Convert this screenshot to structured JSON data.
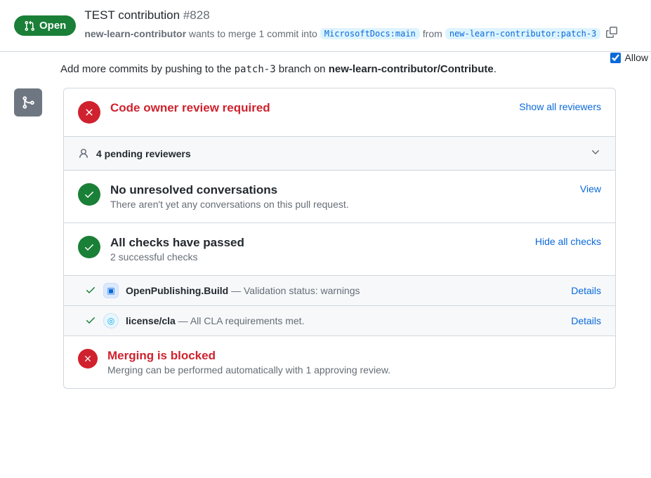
{
  "header": {
    "status_label": "Open",
    "title": "TEST contribution",
    "issue_number": "#828",
    "author": "new-learn-contributor",
    "wants": " wants to merge 1 commit into ",
    "base_branch": "MicrosoftDocs:main",
    "from_word": " from ",
    "head_branch": "new-learn-contributor:patch-3"
  },
  "allow": {
    "label": "Allow"
  },
  "commit_hint": {
    "prefix": "Add more commits by pushing to the ",
    "branch": "patch-3",
    "mid": " branch on ",
    "repo": "new-learn-contributor/Contribute",
    "suffix": "."
  },
  "review": {
    "title": "Code owner review required",
    "show_all": "Show all reviewers",
    "pending": "4 pending reviewers"
  },
  "conversations": {
    "title": "No unresolved conversations",
    "subtitle": "There aren't yet any conversations on this pull request.",
    "view": "View"
  },
  "checks": {
    "title": "All checks have passed",
    "subtitle": "2 successful checks",
    "hide": "Hide all checks",
    "items": [
      {
        "name": "OpenPublishing.Build",
        "desc": " — Validation status: warnings",
        "details": "Details"
      },
      {
        "name": "license/cla",
        "desc": " — All CLA requirements met.",
        "details": "Details"
      }
    ]
  },
  "merge": {
    "title": "Merging is blocked",
    "subtitle": "Merging can be performed automatically with 1 approving review."
  }
}
